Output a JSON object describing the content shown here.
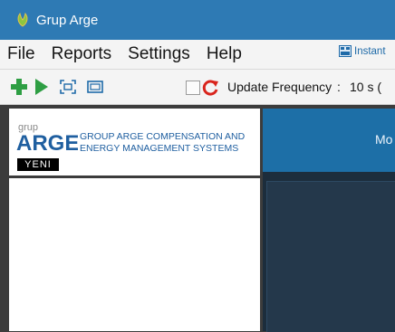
{
  "window": {
    "title": "Grup Arge"
  },
  "menu": {
    "items": [
      {
        "label": "File"
      },
      {
        "label": "Reports"
      },
      {
        "label": "Settings"
      },
      {
        "label": "Help"
      }
    ],
    "instant_label": "Instant"
  },
  "toolbar": {
    "icons": [
      "add-icon",
      "play-icon",
      "fit-screen-icon",
      "fullscreen-icon",
      "refresh-icon"
    ],
    "update_frequency_label": "Update Frequency",
    "separator": ":",
    "update_frequency_value": "10 s ("
  },
  "logo": {
    "grup_text": "grup",
    "arge_text": "ARGE",
    "company_name": "GROUP ARGE COMPENSATION AND ENERGY MANAGEMENT SYSTEMS",
    "badge": "YENI"
  },
  "right_panel": {
    "header_text": "Mo"
  },
  "colors": {
    "titlebar": "#2e7ab4",
    "accent_blue": "#1d6fa7",
    "dark_panel": "#1c2d3c",
    "play_green": "#2e9e43",
    "refresh_red": "#d9241c"
  }
}
